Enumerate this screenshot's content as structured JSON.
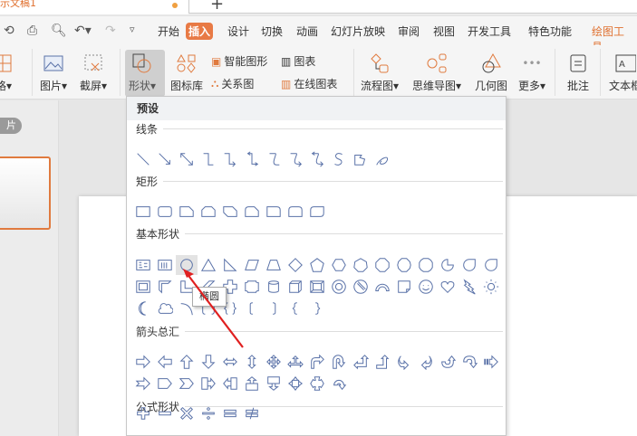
{
  "window": {
    "doc_title": "示文稿1",
    "new_tab": "+"
  },
  "menu": {
    "tabs": [
      "开始",
      "插入",
      "设计",
      "切换",
      "动画",
      "幻灯片放映",
      "审阅",
      "视图",
      "开发工具",
      "特色功能"
    ],
    "active": "插入",
    "drawing_tools": "绘图工具"
  },
  "ribbon": {
    "table": "格",
    "picture": "图片",
    "screenshot": "截屏",
    "shape": "形状",
    "icon_lib": "图标库",
    "smart_art": "智能图形",
    "relation": "关系图",
    "chart": "图表",
    "online_chart": "在线图表",
    "flowchart": "流程图",
    "mindmap": "思维导图",
    "geometry": "几何图",
    "more": "更多",
    "comment": "批注",
    "textbox": "文本框"
  },
  "left_panel": {
    "slides_label": "片"
  },
  "dropdown": {
    "preset": "预设",
    "categories": [
      {
        "label": "线条",
        "rows": [
          [
            "line",
            "arrow",
            "double-arrow",
            "elbow",
            "elbow-arrow",
            "elbow-double-arrow",
            "curve",
            "curve-arrow",
            "curve-double-arrow",
            "s-curve",
            "freeform",
            "scribble"
          ]
        ]
      },
      {
        "label": "矩形",
        "rows": [
          [
            "rect",
            "round-rect",
            "snip1",
            "snip2",
            "snip-diag",
            "round-snip",
            "round1",
            "round2",
            "round-diag"
          ]
        ]
      },
      {
        "label": "基本形状",
        "rows": [
          [
            "textbox",
            "vtextbox",
            "ellipse",
            "triangle",
            "right-triangle",
            "parallelogram",
            "trapezoid",
            "diamond",
            "pentagon",
            "hexagon",
            "heptagon",
            "octagon",
            "decagon",
            "dodecagon",
            "pie",
            "teardrop",
            "chord"
          ],
          [
            "frame",
            "half-frame",
            "l-shape",
            "diag-stripe",
            "cross",
            "plaque",
            "can",
            "cube",
            "bevel",
            "donut",
            "no-symbol",
            "arc-block",
            "folded",
            "smiley",
            "heart",
            "lightning",
            "sun"
          ],
          [
            "moon",
            "cloud",
            "arc",
            "bracket-pair",
            "brace-pair",
            "left-bracket",
            "right-bracket",
            "left-brace",
            "right-brace"
          ]
        ]
      },
      {
        "label": "箭头总汇",
        "rows": [
          [
            "right-arrow",
            "left-arrow",
            "up-arrow",
            "down-arrow",
            "lr-arrow",
            "ud-arrow",
            "quad-arrow",
            "lru-arrow",
            "bent-arrow",
            "uturn-arrow",
            "left-up-arrow",
            "bent-up-arrow",
            "curved-right",
            "curved-left",
            "curved-up",
            "curved-down",
            "striped-right"
          ],
          [
            "notched-right",
            "home-plate",
            "chevron",
            "right-callout",
            "left-callout",
            "up-callout",
            "down-callout",
            "quad-callout",
            "quad-callout2",
            "circular-arrow"
          ]
        ]
      },
      {
        "label": "公式形状",
        "rows": [
          [
            "plus",
            "minus",
            "multiply",
            "divide",
            "equal",
            "not-equal"
          ]
        ]
      }
    ],
    "hovered": "ellipse",
    "tooltip": "椭圆"
  },
  "colors": {
    "accent": "#e87a45",
    "shape_stroke": "#5a72a8",
    "annotation_arrow": "#e02020"
  }
}
